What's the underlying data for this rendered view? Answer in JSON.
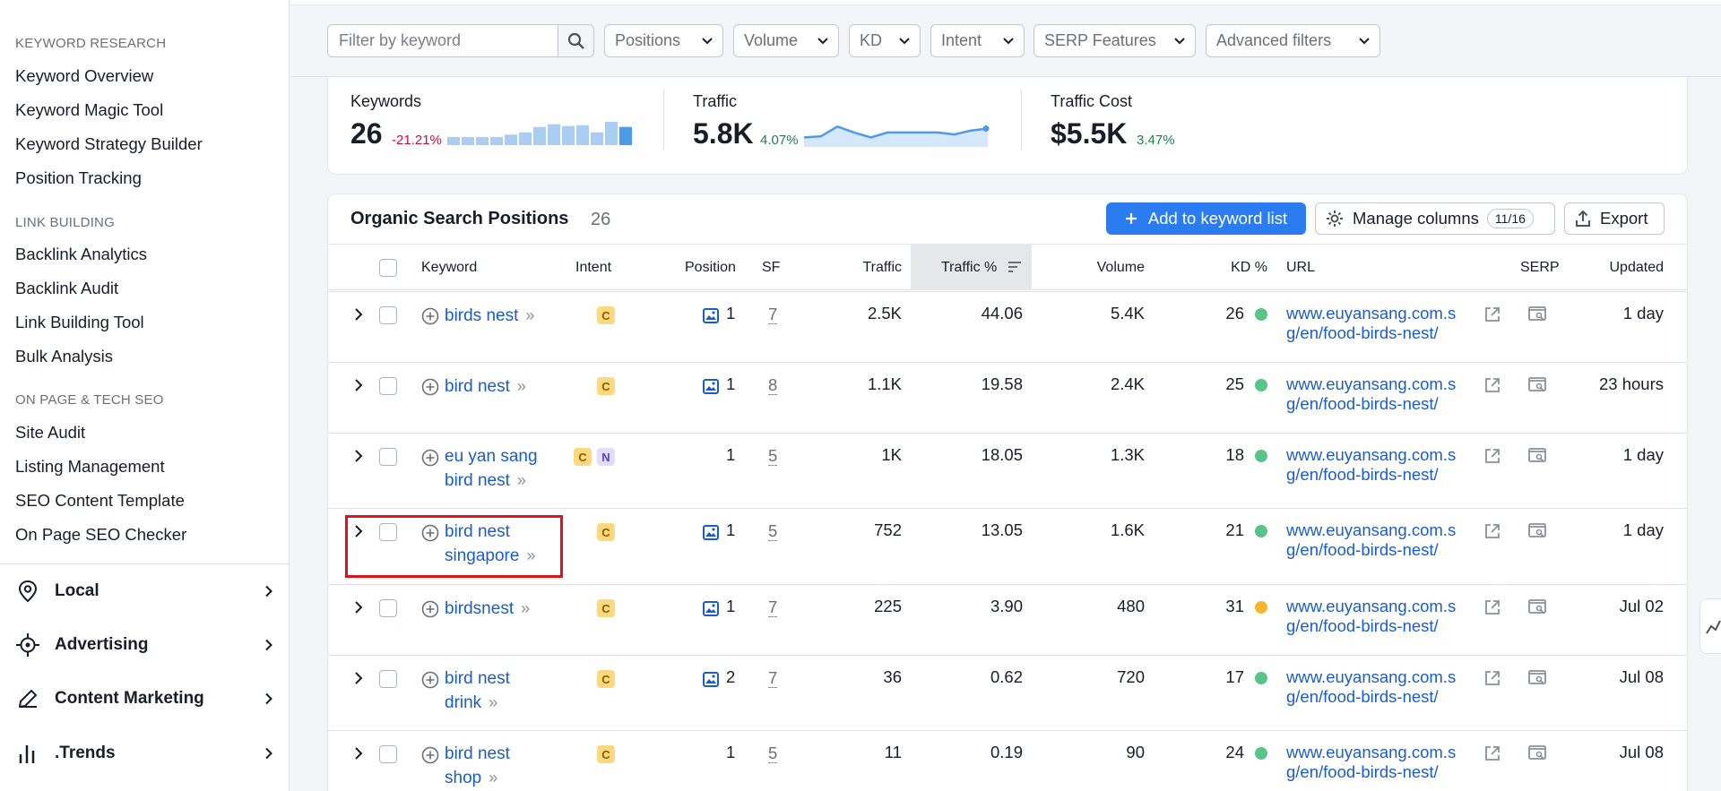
{
  "sidebar": {
    "sections": [
      {
        "title": "KEYWORD RESEARCH",
        "items": [
          "Keyword Overview",
          "Keyword Magic Tool",
          "Keyword Strategy Builder",
          "Position Tracking"
        ]
      },
      {
        "title": "LINK BUILDING",
        "items": [
          "Backlink Analytics",
          "Backlink Audit",
          "Link Building Tool",
          "Bulk Analysis"
        ]
      },
      {
        "title": "ON PAGE & TECH SEO",
        "items": [
          "Site Audit",
          "Listing Management",
          "SEO Content Template",
          "On Page SEO Checker"
        ]
      }
    ],
    "categories": [
      {
        "label": "Local",
        "icon": "location-pin-icon"
      },
      {
        "label": "Advertising",
        "icon": "target-icon"
      },
      {
        "label": "Content Marketing",
        "icon": "pencil-icon"
      },
      {
        "label": ".Trends",
        "icon": "bar-chart-icon"
      }
    ]
  },
  "filters": {
    "search_placeholder": "Filter by keyword",
    "dropdowns": [
      "Positions",
      "Volume",
      "KD",
      "Intent",
      "SERP Features",
      "Advanced filters"
    ]
  },
  "summary": {
    "keywords": {
      "label": "Keywords",
      "value": "26",
      "change": "-21.21%",
      "change_color": "#c8102e"
    },
    "traffic": {
      "label": "Traffic",
      "value": "5.8K",
      "change": "4.07%",
      "change_color": "#1a7f4b"
    },
    "traffic_cost": {
      "label": "Traffic Cost",
      "value": "$5.5K",
      "change": "3.47%",
      "change_color": "#1a7f4b"
    },
    "keyword_bars": [
      0.35,
      0.35,
      0.35,
      0.35,
      0.45,
      0.55,
      0.78,
      0.9,
      0.82,
      0.85,
      0.55,
      1.0,
      0.78
    ],
    "traffic_trend": [
      0.3,
      0.35,
      0.85,
      0.55,
      0.3,
      0.55,
      0.55,
      0.55,
      0.55,
      0.45,
      0.65,
      0.75
    ]
  },
  "table": {
    "title": "Organic Search Positions",
    "count": "26",
    "add_button": "Add to keyword list",
    "manage_columns": "Manage columns",
    "columns_badge": "11/16",
    "export": "Export",
    "headers": {
      "keyword": "Keyword",
      "intent": "Intent",
      "position": "Position",
      "sf": "SF",
      "traffic": "Traffic",
      "traffic_pct": "Traffic %",
      "volume": "Volume",
      "kd": "KD %",
      "url": "URL",
      "serp": "SERP",
      "updated": "Updated"
    },
    "rows": [
      {
        "kw1": "birds nest",
        "kw2": "",
        "intents": [
          "C"
        ],
        "image": true,
        "position": "1",
        "sf": "7",
        "traffic": "2.5K",
        "traffic_pct": "44.06",
        "volume": "5.4K",
        "kd": "26",
        "kd_color": "#59c48a",
        "url1": "www.euyansang.com.s",
        "url2": "g/en/food-birds-nest/",
        "updated": "1 day"
      },
      {
        "kw1": "bird nest",
        "kw2": "",
        "intents": [
          "C"
        ],
        "image": true,
        "position": "1",
        "sf": "8",
        "traffic": "1.1K",
        "traffic_pct": "19.58",
        "volume": "2.4K",
        "kd": "25",
        "kd_color": "#59c48a",
        "url1": "www.euyansang.com.s",
        "url2": "g/en/food-birds-nest/",
        "updated": "23 hours"
      },
      {
        "kw1": "eu yan sang",
        "kw2": "bird nest",
        "intents": [
          "C",
          "N"
        ],
        "image": false,
        "position": "1",
        "sf": "5",
        "traffic": "1K",
        "traffic_pct": "18.05",
        "volume": "1.3K",
        "kd": "18",
        "kd_color": "#59c48a",
        "url1": "www.euyansang.com.s",
        "url2": "g/en/food-birds-nest/",
        "updated": "1 day"
      },
      {
        "kw1": "bird nest",
        "kw2": "singapore",
        "intents": [
          "C"
        ],
        "image": true,
        "position": "1",
        "sf": "5",
        "traffic": "752",
        "traffic_pct": "13.05",
        "volume": "1.6K",
        "kd": "21",
        "kd_color": "#59c48a",
        "url1": "www.euyansang.com.s",
        "url2": "g/en/food-birds-nest/",
        "updated": "1 day"
      },
      {
        "kw1": "birdsnest",
        "kw2": "",
        "intents": [
          "C"
        ],
        "image": true,
        "position": "1",
        "sf": "7",
        "traffic": "225",
        "traffic_pct": "3.90",
        "volume": "480",
        "kd": "31",
        "kd_color": "#f5b731",
        "url1": "www.euyansang.com.s",
        "url2": "g/en/food-birds-nest/",
        "updated": "Jul 02"
      },
      {
        "kw1": "bird nest",
        "kw2": "drink",
        "intents": [
          "C"
        ],
        "image": true,
        "position": "2",
        "sf": "7",
        "traffic": "36",
        "traffic_pct": "0.62",
        "volume": "720",
        "kd": "17",
        "kd_color": "#59c48a",
        "url1": "www.euyansang.com.s",
        "url2": "g/en/food-birds-nest/",
        "updated": "Jul 08"
      },
      {
        "kw1": "bird nest",
        "kw2": "shop",
        "intents": [
          "C"
        ],
        "image": false,
        "position": "1",
        "sf": "5",
        "traffic": "11",
        "traffic_pct": "0.19",
        "volume": "90",
        "kd": "24",
        "kd_color": "#59c48a",
        "url1": "www.euyansang.com.s",
        "url2": "g/en/food-birds-nest/",
        "updated": "Jul 08"
      }
    ]
  },
  "colors": {
    "accent": "#2b7cf0",
    "link": "#1b5dc7",
    "highlight": "#e0131a",
    "chart": "#4c9bea"
  }
}
